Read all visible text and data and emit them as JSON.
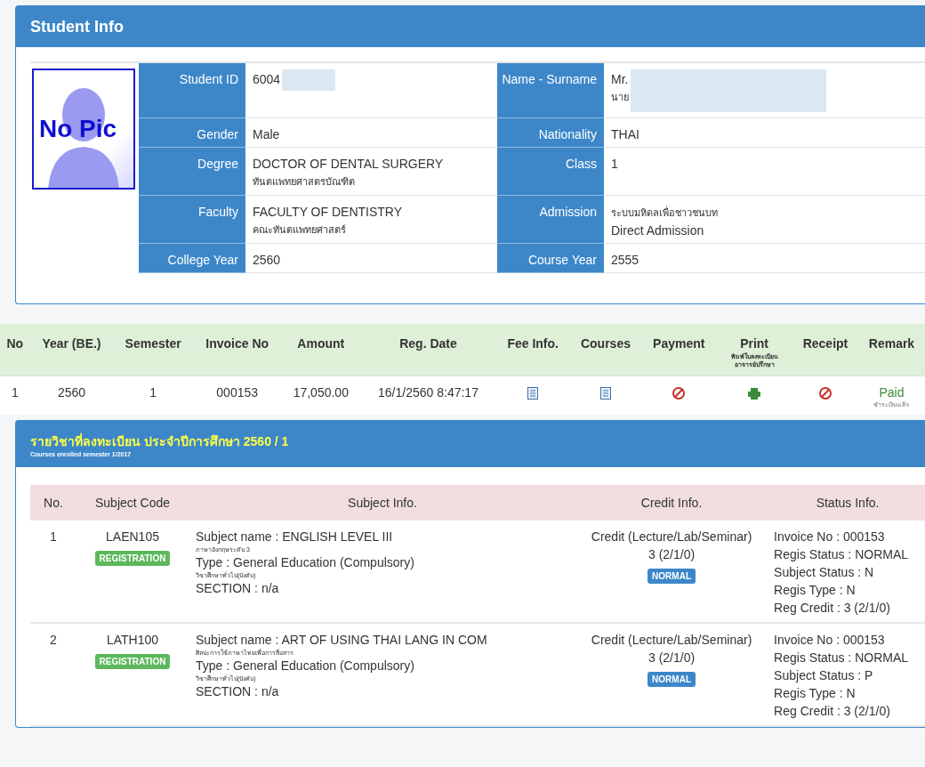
{
  "student_info": {
    "title": "Student Info",
    "photo_label": "No Pic",
    "rows": [
      [
        {
          "label": "Student ID",
          "redacted": true,
          "lines": [
            {
              "text": "6004",
              "kind": "main"
            }
          ]
        },
        {
          "label": "Name - Surname",
          "redacted": true,
          "lines": [
            {
              "text": "Mr.",
              "kind": "main"
            },
            {
              "text": "นาย",
              "kind": "sub"
            }
          ]
        }
      ],
      [
        {
          "label": "Gender",
          "redacted": false,
          "lines": [
            {
              "text": "Male",
              "kind": "main"
            }
          ]
        },
        {
          "label": "Nationality",
          "redacted": false,
          "lines": [
            {
              "text": "THAI",
              "kind": "main"
            }
          ]
        }
      ],
      [
        {
          "label": "Degree",
          "redacted": false,
          "lines": [
            {
              "text": "DOCTOR OF DENTAL SURGERY",
              "kind": "main"
            },
            {
              "text": "ทันตแพทยศาสตรบัณฑิต",
              "kind": "sub"
            }
          ]
        },
        {
          "label": "Class",
          "redacted": false,
          "lines": [
            {
              "text": "1",
              "kind": "main"
            }
          ]
        }
      ],
      [
        {
          "label": "Faculty",
          "redacted": false,
          "lines": [
            {
              "text": "FACULTY OF DENTISTRY",
              "kind": "main"
            },
            {
              "text": "คณะทันตแพทยศาสตร์",
              "kind": "sub"
            }
          ]
        },
        {
          "label": "Admission",
          "redacted": false,
          "lines": [
            {
              "text": "ระบบมหิดลเพื่อชาวชนบท",
              "kind": "sub"
            },
            {
              "text": "Direct Admission",
              "kind": "main"
            }
          ]
        }
      ],
      [
        {
          "label": "College Year",
          "redacted": false,
          "lines": [
            {
              "text": "2560",
              "kind": "main"
            }
          ]
        },
        {
          "label": "Course Year",
          "redacted": false,
          "lines": [
            {
              "text": "2555",
              "kind": "main"
            }
          ]
        }
      ]
    ]
  },
  "fee_table": {
    "columns": [
      {
        "label": "No"
      },
      {
        "label": "Year (BE.)"
      },
      {
        "label": "Semester"
      },
      {
        "label": "Invoice No"
      },
      {
        "label": "Amount"
      },
      {
        "label": "Reg. Date"
      },
      {
        "label": "Fee Info."
      },
      {
        "label": "Courses"
      },
      {
        "label": "Payment"
      },
      {
        "label": "Print",
        "sub": "พิมพ์ใบลงทะเบียน อาจารย์ปรึกษา"
      },
      {
        "label": "Receipt"
      },
      {
        "label": "Remark"
      }
    ],
    "rows": [
      [
        {
          "kind": "text",
          "text": "1"
        },
        {
          "kind": "text",
          "text": "2560"
        },
        {
          "kind": "text",
          "text": "1"
        },
        {
          "kind": "text",
          "text": "000153"
        },
        {
          "kind": "text",
          "text": "17,050.00"
        },
        {
          "kind": "text",
          "text": "16/1/2560 8:47:17"
        },
        {
          "kind": "doc"
        },
        {
          "kind": "doc"
        },
        {
          "kind": "blocked"
        },
        {
          "kind": "print"
        },
        {
          "kind": "blocked"
        },
        {
          "kind": "status",
          "text": "Paid",
          "sub": "ชำระเงินแล้ว"
        }
      ]
    ]
  },
  "courses": {
    "title": "รายวิชาที่ลงทะเบียน ประจำปีการศึกษา 2560 / 1",
    "subtitle": "Courses enrolled semester 1/2017",
    "columns": [
      "No.",
      "Subject Code",
      "Subject Info.",
      "Credit Info.",
      "Status Info."
    ],
    "rows": [
      {
        "no": "1",
        "code": "LAEN105",
        "badge": "REGISTRATION",
        "info": [
          {
            "text": "Subject name : ENGLISH LEVEL III",
            "kind": "main"
          },
          {
            "text": "ภาษาอังกฤษระดับ 3",
            "kind": "sub"
          },
          {
            "text": "Type : General Education (Compulsory)",
            "kind": "main"
          },
          {
            "text": "วิชาศึกษาทั่วไป(บังคับ)",
            "kind": "sub"
          },
          {
            "text": "SECTION : n/a",
            "kind": "main"
          }
        ],
        "credit": [
          "Credit (Lecture/Lab/Seminar)",
          "3 (2/1/0)"
        ],
        "credit_badge": "NORMAL",
        "status": [
          "Invoice No : 000153",
          "Regis Status : NORMAL",
          "Subject Status : N",
          "Regis Type : N",
          "Reg Credit : 3 (2/1/0)"
        ]
      },
      {
        "no": "2",
        "code": "LATH100",
        "badge": "REGISTRATION",
        "info": [
          {
            "text": "Subject name : ART OF USING THAI LANG IN COM",
            "kind": "main"
          },
          {
            "text": "ศิลปะการใช้ภาษาไทยเพื่อการสื่อสาร",
            "kind": "sub"
          },
          {
            "text": "Type : General Education (Compulsory)",
            "kind": "main"
          },
          {
            "text": "วิชาศึกษาทั่วไป(บังคับ)",
            "kind": "sub"
          },
          {
            "text": "SECTION : n/a",
            "kind": "main"
          }
        ],
        "credit": [
          "Credit (Lecture/Lab/Seminar)",
          "3 (2/1/0)"
        ],
        "credit_badge": "NORMAL",
        "status": [
          "Invoice No : 000153",
          "Regis Status : NORMAL",
          "Subject Status : P",
          "Regis Type : N",
          "Reg Credit : 3 (2/1/0)"
        ]
      }
    ]
  }
}
